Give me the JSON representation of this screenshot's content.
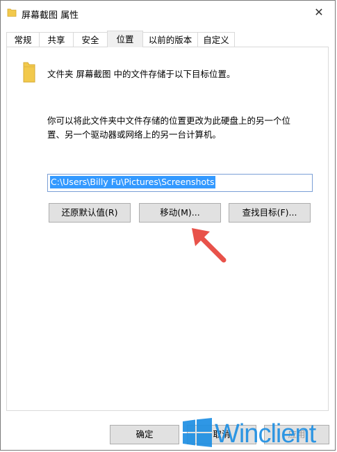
{
  "window": {
    "title": "屏幕截图 属性",
    "close_glyph": "✕"
  },
  "tabs": [
    {
      "label": "常规"
    },
    {
      "label": "共享"
    },
    {
      "label": "安全"
    },
    {
      "label": "位置",
      "active": true
    },
    {
      "label": "以前的版本"
    },
    {
      "label": "自定义"
    }
  ],
  "panel": {
    "description": "文件夹 屏幕截图 中的文件存储于以下目标位置。",
    "info_line1": "你可以将此文件夹中文件存储的位置更改为此硬盘上的另一个位",
    "info_line2": "置、另一个驱动器或网络上的另一台计算机。",
    "path_value": "C:\\Users\\Billy Fu\\Pictures\\Screenshots",
    "restore_button": "还原默认值(R)",
    "move_button": "移动(M)...",
    "find_target_button": "查找目标(F)..."
  },
  "footer": {
    "ok_button": "确定",
    "cancel_button": "取消",
    "apply_button": "应用"
  },
  "watermark": {
    "text": "Winclient"
  },
  "colors": {
    "accent": "#3399ff",
    "arrow": "#e8524a",
    "folder": "#f2c94c",
    "watermark": "#1e8fe3"
  },
  "icons": {
    "title_icon": "folder-icon",
    "close_icon": "close-icon",
    "annotation": "red-arrow"
  }
}
